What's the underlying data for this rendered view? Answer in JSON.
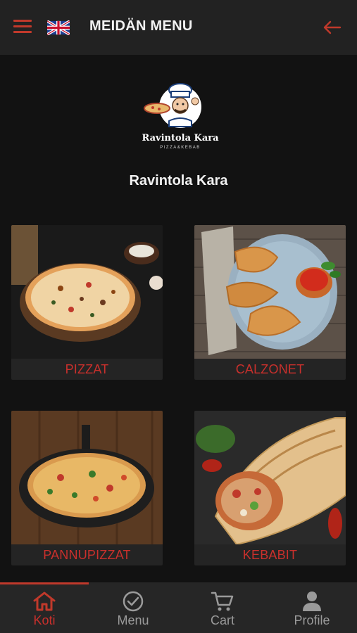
{
  "header": {
    "title": "MEIDÄN MENU",
    "menu_icon": "hamburger-icon",
    "language_icon": "uk-flag-icon",
    "back_icon": "arrow-left-icon"
  },
  "restaurant": {
    "name": "Ravintola Kara",
    "logo_text": "Ravintola Kara",
    "logo_subtext": "PIZZA&KEBAB"
  },
  "categories": [
    {
      "label": "PIZZAT",
      "image": "pizza-photo"
    },
    {
      "label": "CALZONET",
      "image": "calzone-photo"
    },
    {
      "label": "PANNUPIZZAT",
      "image": "pan-pizza-photo"
    },
    {
      "label": "KEBABIT",
      "image": "kebab-wrap-photo"
    }
  ],
  "bottom_nav": [
    {
      "label": "Koti",
      "icon": "home-icon",
      "active": true
    },
    {
      "label": "Menu",
      "icon": "check-circle-icon",
      "active": false
    },
    {
      "label": "Cart",
      "icon": "cart-icon",
      "active": false
    },
    {
      "label": "Profile",
      "icon": "user-icon",
      "active": false
    }
  ],
  "colors": {
    "accent": "#c0392b",
    "background": "#121212",
    "header": "#222222",
    "card": "#242424",
    "nav": "#262626"
  }
}
